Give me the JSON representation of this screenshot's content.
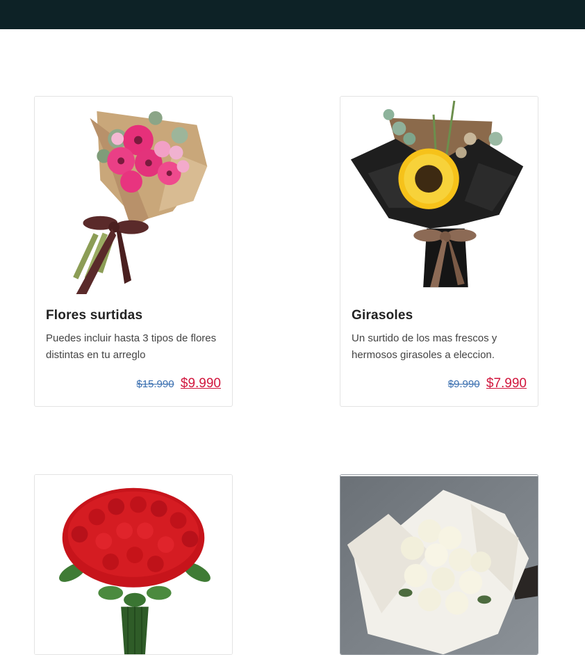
{
  "header": {
    "bg_color": "#0d2226"
  },
  "products": [
    {
      "title": "Flores surtidas",
      "description": "Puedes incluir hasta 3 tipos de flores distintas en tu arreglo",
      "old_price": "$15.990",
      "price": "$9.990",
      "image": "pink-gerbera-bouquet"
    },
    {
      "title": "Girasoles",
      "description": "Un surtido de los mas frescos y hermosos girasoles a eleccion.",
      "old_price": "$9.990",
      "price": "$7.990",
      "image": "sunflower-bouquet"
    },
    {
      "title": "",
      "description": "",
      "old_price": "",
      "price": "",
      "image": "red-roses-bouquet"
    },
    {
      "title": "",
      "description": "",
      "old_price": "",
      "price": "",
      "image": "white-roses-bouquet"
    }
  ],
  "colors": {
    "old_price": "#3a6fb0",
    "price": "#d1163d"
  }
}
